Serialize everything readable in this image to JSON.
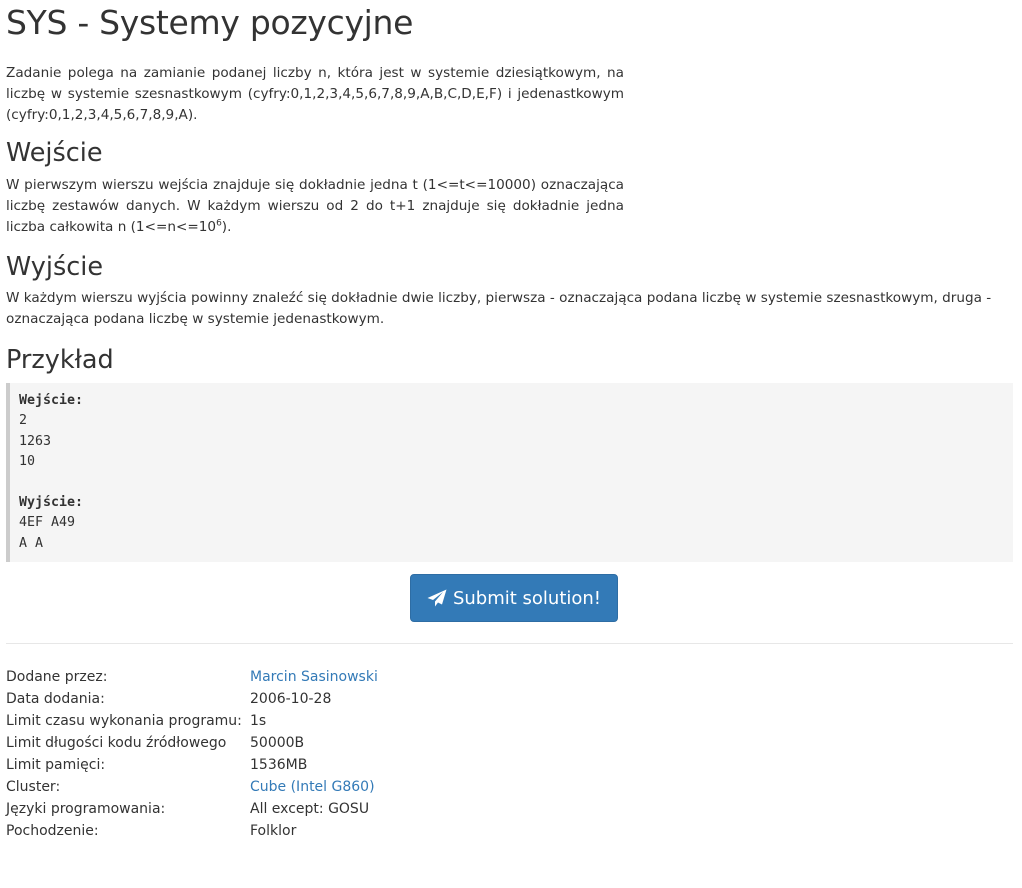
{
  "problem": {
    "title": "SYS - Systemy pozycyjne",
    "intro": "Zadanie polega na zamianie podanej liczby n, która jest w systemie dziesiątkowym, na liczbę w systemie szesnastkowym (cyfry:0,1,2,3,4,5,6,7,8,9,A,B,C,D,E,F) i jedenastkowym (cyfry:0,1,2,3,4,5,6,7,8,9,A).",
    "input_heading": "Wejście",
    "input_text_pre": "W pierwszym wierszu wejścia znajduje się dokładnie jedna t (1<=t<=10000) oznaczająca liczbę zestawów danych. W każdym wierszu od 2 do t+1 znajduje się dokładnie jedna liczba całkowita n (1<=n<=10",
    "input_text_sup": "6",
    "input_text_post": ").",
    "output_heading": "Wyjście",
    "output_text": "W każdym wierszu wyjścia powinny znaleźć się dokładnie dwie liczby, pierwsza - oznaczająca podana liczbę w systemie szesnastkowym, druga - oznaczająca podana liczbę w systemie jedenastkowym.",
    "example_heading": "Przykład",
    "example": {
      "input_label": "Wejście:",
      "input_lines": "2\n1263\n10",
      "output_label": "Wyjście:",
      "output_lines": "4EF A49\nA A"
    }
  },
  "submit": {
    "label": "Submit solution!",
    "icon": "paper-plane-icon"
  },
  "info": {
    "added_by_label": "Dodane przez:",
    "added_by_value": "Marcin Sasinowski",
    "date_label": "Data dodania:",
    "date_value": "2006-10-28",
    "time_limit_label": "Limit czasu wykonania programu:",
    "time_limit_value": "1s",
    "code_limit_label": "Limit długości kodu źródłowego",
    "code_limit_value": "50000B",
    "memory_label": "Limit pamięci:",
    "memory_value": "1536MB",
    "cluster_label": "Cluster:",
    "cluster_value": "Cube (Intel G860)",
    "languages_label": "Języki programowania:",
    "languages_value": "All except: GOSU",
    "origin_label": "Pochodzenie:",
    "origin_value": "Folklor"
  },
  "colors": {
    "link": "#337ab7",
    "button_bg": "#337ab7",
    "text": "#333333",
    "example_bg": "#f5f5f5",
    "example_border": "#cccccc"
  }
}
